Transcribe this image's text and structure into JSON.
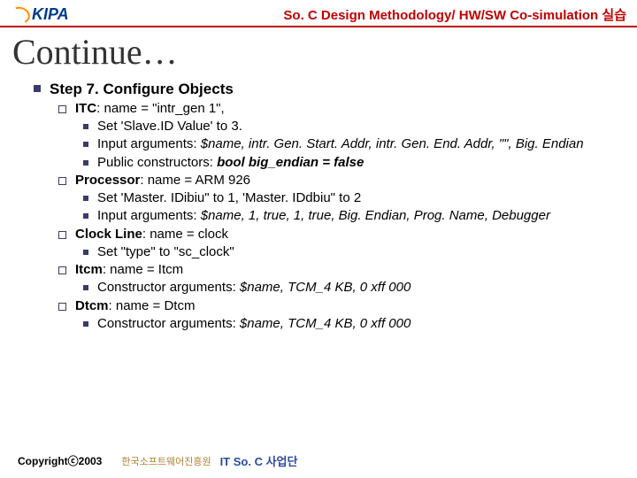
{
  "header": {
    "logo_text": "KIPA",
    "title": "So. C Design Methodology/ HW/SW Co-simulation 실습"
  },
  "slide_title": "Continue…",
  "step": {
    "heading": "Step 7. Configure Objects",
    "items": [
      {
        "label_prefix": "ITC",
        "label_rest": ": name = \"intr_gen 1\",",
        "subs": [
          {
            "plain": "Set 'Slave.ID Value' to 3."
          },
          {
            "prefix": "Input arguments: ",
            "italic": "$name, intr. Gen. Start. Addr, intr. Gen. End. Addr, \"\", Big. Endian"
          },
          {
            "prefix": "Public constructors: ",
            "bolditalic": "bool big_endian = false"
          }
        ]
      },
      {
        "label_prefix": "Processor",
        "label_rest": ": name = ARM 926",
        "subs": [
          {
            "plain": "Set 'Master. IDibiu\" to 1, 'Master. IDdbiu\" to 2"
          },
          {
            "prefix": "Input arguments: ",
            "italic": "$name, 1, true, 1, true, Big. Endian, Prog. Name, Debugger"
          }
        ]
      },
      {
        "label_prefix": "Clock Line",
        "label_rest": ": name = clock",
        "subs": [
          {
            "plain": "Set \"type\" to \"sc_clock\""
          }
        ]
      },
      {
        "label_prefix": "Itcm",
        "label_rest": ": name = Itcm",
        "subs": [
          {
            "prefix": "Constructor arguments: ",
            "italic": "$name, TCM_4 KB, 0 xff 000"
          }
        ]
      },
      {
        "label_prefix": "Dtcm",
        "label_rest": ": name = Dtcm",
        "subs": [
          {
            "prefix": "Constructor arguments: ",
            "italic": "$name, TCM_4 KB, 0 xff 000"
          }
        ]
      }
    ]
  },
  "footer": {
    "copyright": "Copyrightⓒ2003",
    "label": "한국소프트웨어진흥원",
    "org": "IT So. C 사업단"
  }
}
